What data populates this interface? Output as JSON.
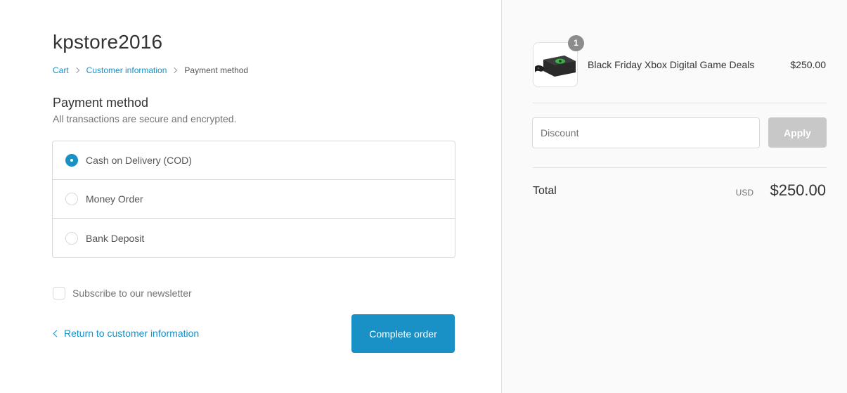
{
  "store": {
    "title": "kpstore2016"
  },
  "breadcrumb": {
    "items": [
      {
        "label": "Cart"
      },
      {
        "label": "Customer information"
      },
      {
        "label": "Payment method"
      }
    ]
  },
  "payment": {
    "title": "Payment method",
    "subtitle": "All transactions are secure and encrypted.",
    "options": [
      {
        "label": "Cash on Delivery (COD)",
        "selected": true
      },
      {
        "label": "Money Order",
        "selected": false
      },
      {
        "label": "Bank Deposit",
        "selected": false
      }
    ]
  },
  "newsletter": {
    "label": "Subscribe to our newsletter",
    "checked": false
  },
  "navigation": {
    "return_label": "Return to customer information",
    "complete_label": "Complete order"
  },
  "summary": {
    "product": {
      "name": "Black Friday Xbox Digital Game Deals",
      "price": "$250.00",
      "quantity": "1",
      "image_icon": "game-console-icon"
    },
    "discount": {
      "placeholder": "Discount",
      "apply_label": "Apply"
    },
    "total": {
      "label": "Total",
      "currency": "USD",
      "amount": "$250.00"
    }
  },
  "colors": {
    "accent": "#1990c6",
    "sidebar_bg": "#fafafa",
    "disabled_button": "#c8c8c8"
  }
}
